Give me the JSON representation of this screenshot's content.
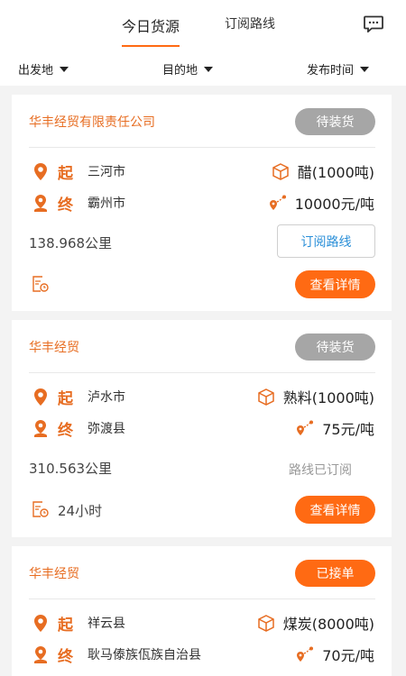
{
  "header": {
    "tab_today": "今日货源",
    "tab_routes": "订阅路线"
  },
  "filters": {
    "origin": "出发地",
    "destination": "目的地",
    "publish_time": "发布时间"
  },
  "cards": [
    {
      "company": "华丰经贸有限责任公司",
      "status": "待装货",
      "start_tag": "起",
      "start_city": "三河市",
      "end_tag": "终",
      "end_city": "霸州市",
      "cargo": "醋(1000吨)",
      "price": "10000元/吨",
      "distance": "138.968公里",
      "subscribe": "订阅路线",
      "detail": "查看详情"
    },
    {
      "company": "华丰经贸",
      "status": "待装货",
      "start_tag": "起",
      "start_city": "泸水市",
      "end_tag": "终",
      "end_city": "弥渡县",
      "cargo": "熟料(1000吨)",
      "price": "75元/吨",
      "distance": "310.563公里",
      "subscribed": "路线已订阅",
      "valid": "24小时",
      "detail": "查看详情"
    },
    {
      "company": "华丰经贸",
      "status": "已接单",
      "start_tag": "起",
      "start_city": "祥云县",
      "end_tag": "终",
      "end_city": "耿马傣族佤族自治县",
      "cargo": "煤炭(8000吨)",
      "price": "70元/吨"
    }
  ],
  "colors": {
    "accent": "#ff6a13",
    "company_text": "#e76d22",
    "link_blue": "#2a8fd8",
    "status_grey": "#a6a6a6"
  },
  "icons": [
    "chat-icon",
    "dropdown-triangle-icon",
    "location-pin-icon",
    "user-pin-icon",
    "package-icon",
    "route-icon",
    "document-clock-icon"
  ]
}
